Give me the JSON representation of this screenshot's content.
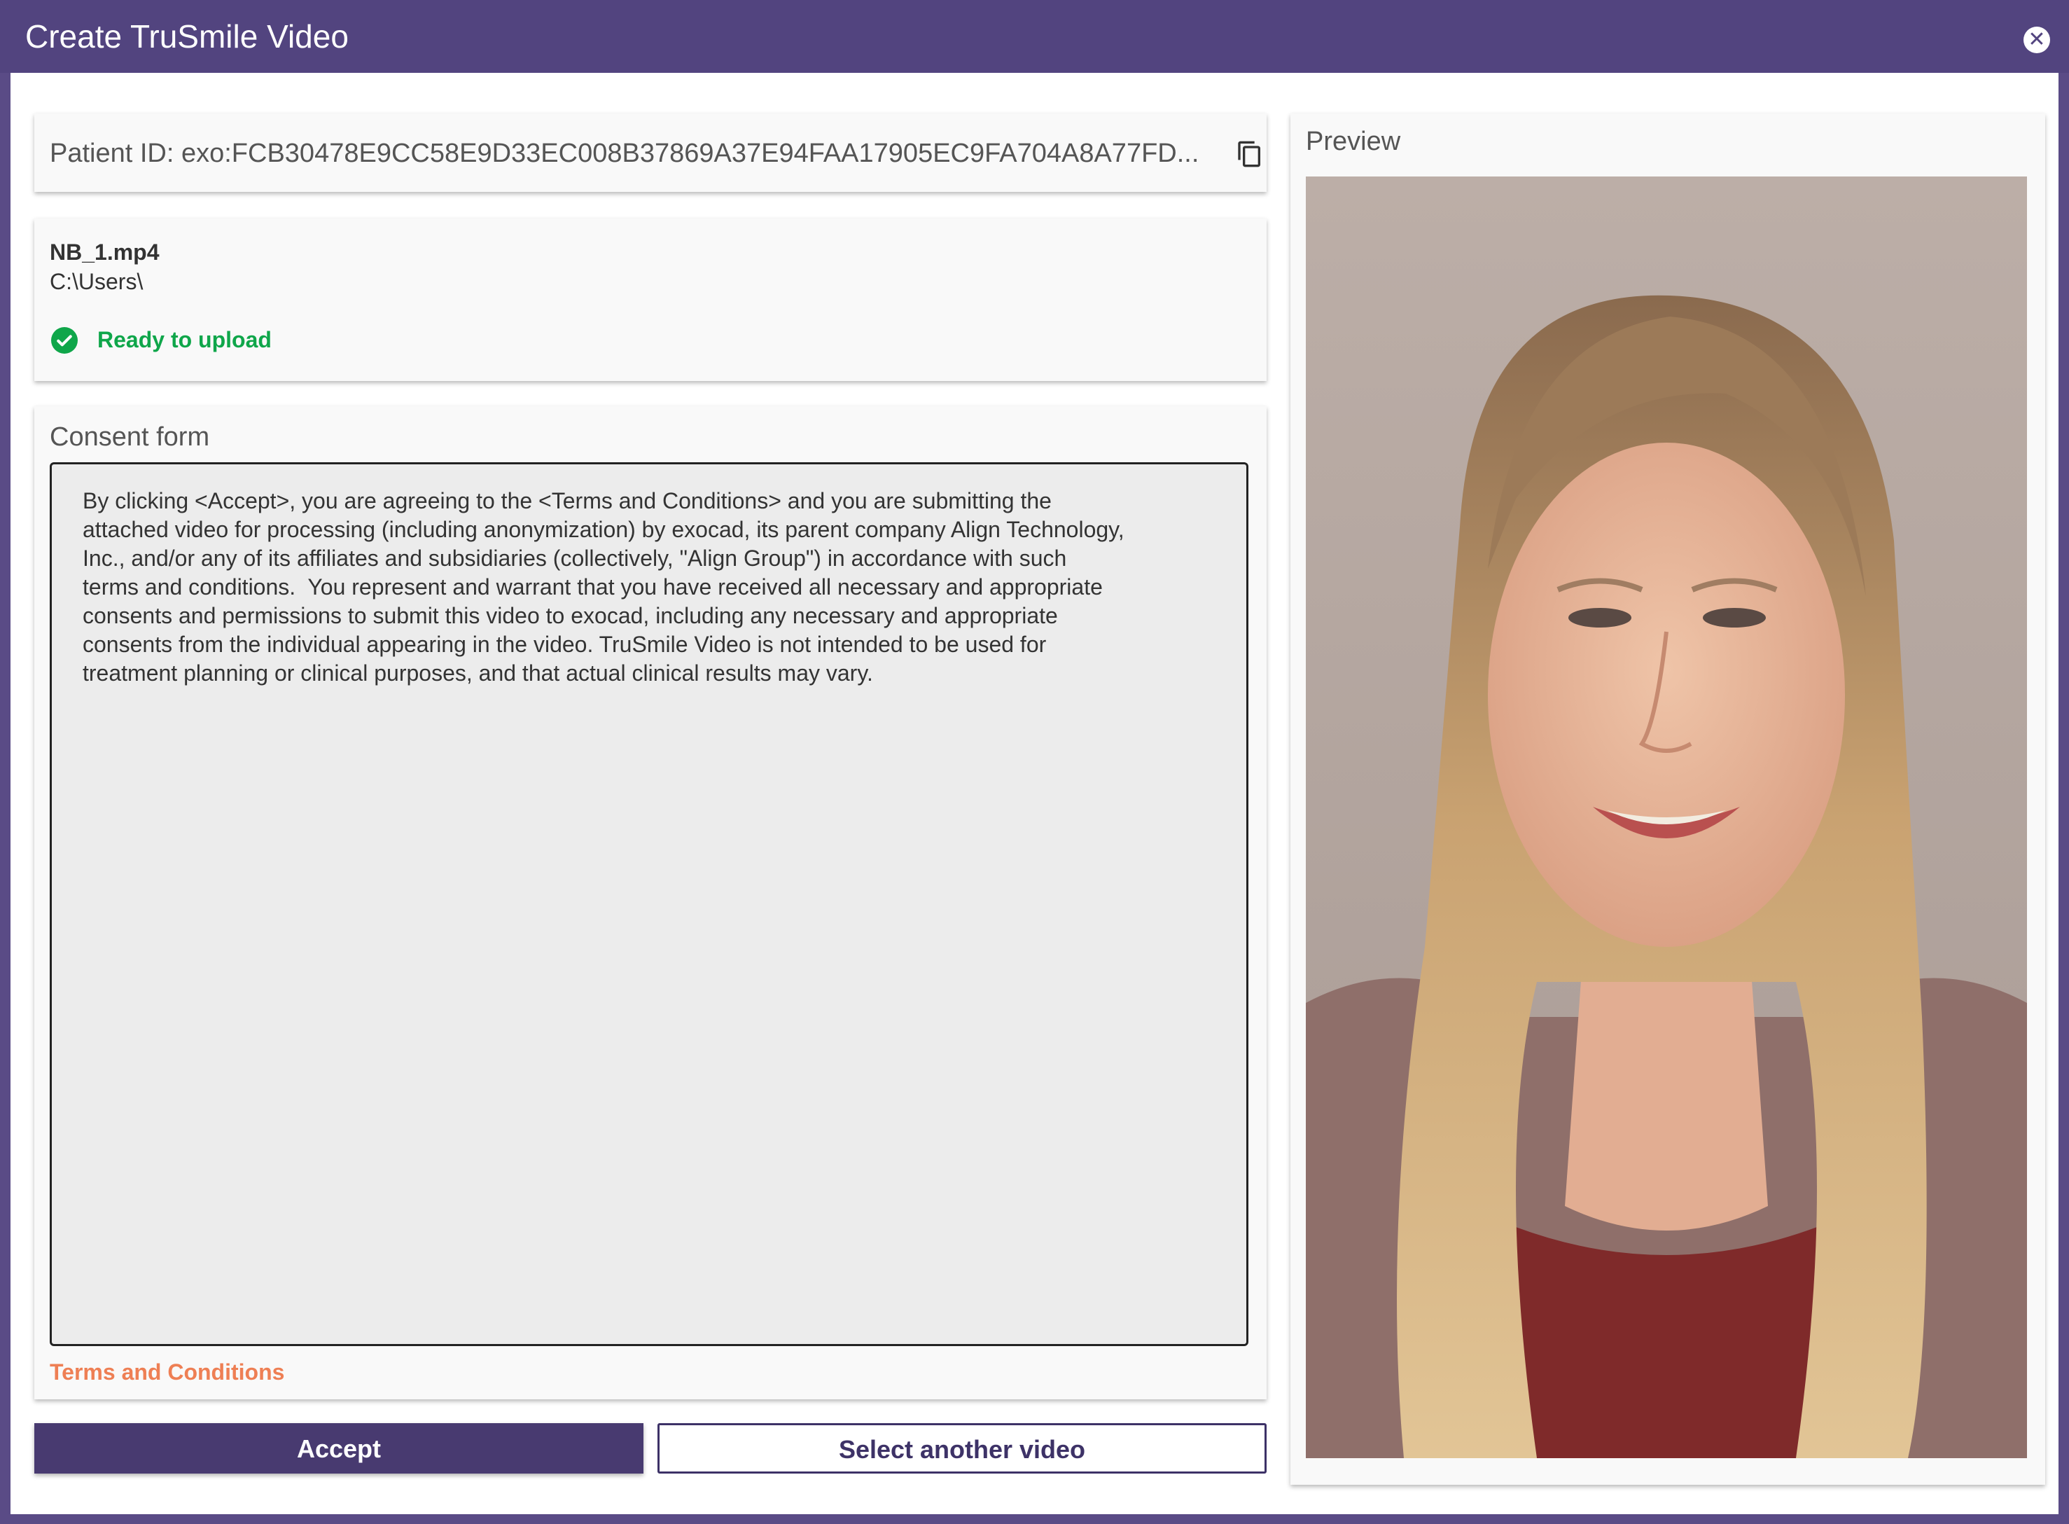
{
  "window": {
    "title": "Create TruSmile Video",
    "close_icon": "close-circle-icon"
  },
  "patient": {
    "label": "Patient ID: exo:FCB30478E9CC58E9D33EC008B37869A37E94FAA17905EC9FA704A8A77FD...",
    "copy_icon": "copy-icon"
  },
  "file": {
    "name": "NB_1.mp4",
    "path": "C:\\Users\\",
    "status": "Ready to upload",
    "status_icon": "check-circle-icon",
    "status_color": "#0fa64a"
  },
  "consent": {
    "title": "Consent form",
    "text": "By clicking <Accept>, you are agreeing to the <Terms and Conditions> and you are submitting the\nattached video for processing (including anonymization) by exocad, its parent company Align Technology,\nInc., and/or any of its affiliates and subsidiaries (collectively, \"Align Group\") in accordance with such\nterms and conditions.  You represent and warrant that you have received all necessary and appropriate\nconsents and permissions to submit this video to exocad, including any necessary and appropriate\nconsents from the individual appearing in the video. TruSmile Video is not intended to be used for\ntreatment planning or clinical purposes, and that actual clinical results may vary.",
    "terms_link": "Terms and Conditions",
    "link_color": "#ee7f54"
  },
  "actions": {
    "accept_label": "Accept",
    "select_label": "Select another video"
  },
  "preview": {
    "title": "Preview"
  },
  "colors": {
    "brand": "#52447f",
    "button": "#483a70"
  }
}
